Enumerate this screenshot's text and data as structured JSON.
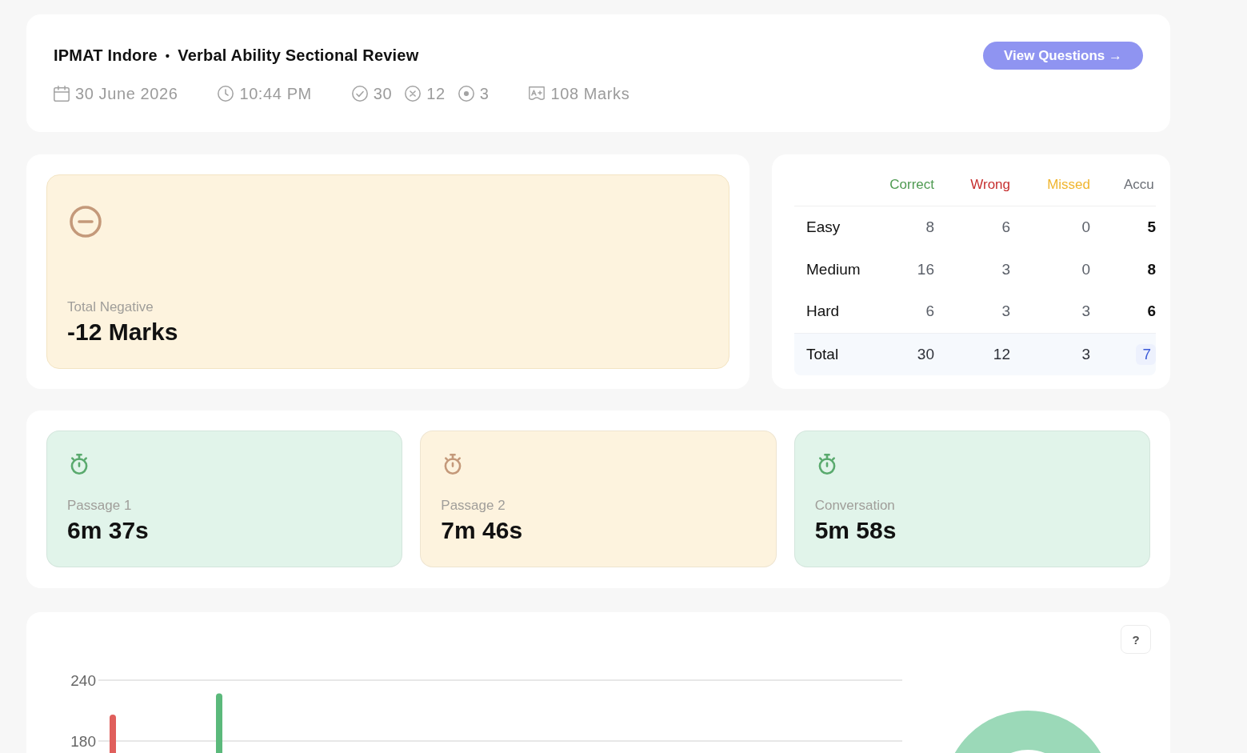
{
  "header": {
    "exam": "IPMAT Indore",
    "separator": "•",
    "title": "Verbal Ability Sectional Review",
    "meta": [
      {
        "kind": "date",
        "text": "30 June 2026"
      },
      {
        "kind": "time",
        "text": "10:44 PM"
      },
      {
        "kind": "correct",
        "text": "30"
      },
      {
        "kind": "wrong",
        "text": "12"
      },
      {
        "kind": "missed",
        "text": "3"
      },
      {
        "kind": "marks",
        "text": "108 Marks"
      }
    ],
    "button": "View Questions →"
  },
  "negative": {
    "label": "Total Negative",
    "value": "-12 Marks"
  },
  "score_table": {
    "columns": [
      {
        "label": "Correct",
        "kind": "count",
        "color": "#4e9a51"
      },
      {
        "label": "Wrong",
        "kind": "count",
        "color": "#c62f2f"
      },
      {
        "label": "Missed",
        "kind": "count",
        "color": "#f0b52e"
      },
      {
        "label": "Accu",
        "kind": "accuracy",
        "color": "#6b6f76"
      }
    ],
    "rows": [
      {
        "label": "Easy",
        "kind": "level",
        "values": [
          "8",
          "6",
          "0",
          "5"
        ]
      },
      {
        "label": "Medium",
        "kind": "level",
        "values": [
          "16",
          "3",
          "0",
          "8"
        ]
      },
      {
        "label": "Hard",
        "kind": "level",
        "values": [
          "6",
          "3",
          "3",
          "6"
        ]
      },
      {
        "label": "Total",
        "kind": "total",
        "values": [
          "30",
          "12",
          "3",
          "7"
        ]
      }
    ]
  },
  "section_times": [
    {
      "label": "Passage 1",
      "value": "6m 37s",
      "color": "#e1f4ea"
    },
    {
      "label": "Passage 2",
      "value": "7m 46s",
      "color": "#fdf3de"
    },
    {
      "label": "Conversation",
      "value": "5m 58s",
      "color": "#e1f4ea"
    }
  ],
  "chart_panel": {
    "help": "?",
    "chart_data": {
      "type": "bar",
      "ylim": [
        0,
        240
      ],
      "yticks": [
        180,
        240
      ],
      "stacked": false,
      "series": [
        {
          "color": "#e05f5c",
          "values": [
            206
          ]
        },
        {
          "color": "#5bb97b",
          "values": [
            227
          ]
        }
      ]
    }
  }
}
